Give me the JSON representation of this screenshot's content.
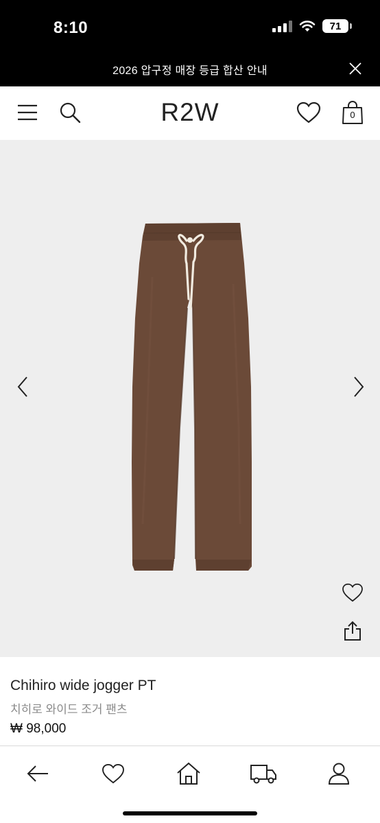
{
  "status_bar": {
    "time": "8:10",
    "battery": "71"
  },
  "announcement": {
    "text": "2026 압구정 매장 등급 합산 안내"
  },
  "header": {
    "logo": "R2W",
    "cart_count": "0"
  },
  "product": {
    "name_en": "Chihiro wide jogger PT",
    "name_ko": "치히로 와이드 조거 팬츠",
    "price": "₩ 98,000",
    "image_background": "#eeeeee",
    "pants_color": "#6b4a38",
    "drawstring_color": "#f1ebe0"
  },
  "icons": {
    "menu": "menu-icon",
    "search": "search-icon",
    "wishlist": "heart-icon",
    "cart": "bag-icon",
    "prev": "chevron-left-icon",
    "next": "chevron-right-icon",
    "share": "share-icon",
    "back": "arrow-left-icon",
    "home": "home-icon",
    "delivery": "truck-icon",
    "account": "user-icon"
  }
}
